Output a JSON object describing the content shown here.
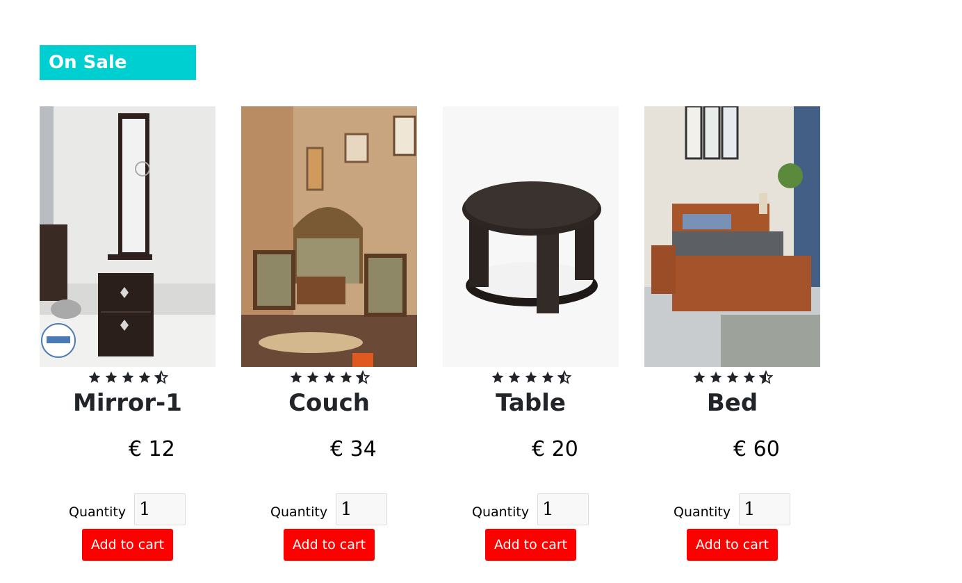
{
  "section": {
    "title": "On Sale"
  },
  "products": [
    {
      "name": "Mirror-1",
      "price": "€ 12",
      "quantity_label": "Quantity",
      "quantity": "1",
      "button": "Add to cart",
      "rating": 4.5
    },
    {
      "name": "Couch",
      "price": "€ 34",
      "quantity_label": "Quantity",
      "quantity": "1",
      "button": "Add to cart",
      "rating": 4.5
    },
    {
      "name": "Table",
      "price": "€ 20",
      "quantity_label": "Quantity",
      "quantity": "1",
      "button": "Add to cart",
      "rating": 4.5
    },
    {
      "name": "Bed",
      "price": "€ 60",
      "quantity_label": "Quantity",
      "quantity": "1",
      "button": "Add to cart",
      "rating": 4.5
    }
  ],
  "colors": {
    "section_bg": "#00cfd1",
    "button_bg": "#ff0000",
    "star": "#212529"
  },
  "icons": {
    "full_star": "star-icon",
    "half_star": "star-half-icon"
  }
}
